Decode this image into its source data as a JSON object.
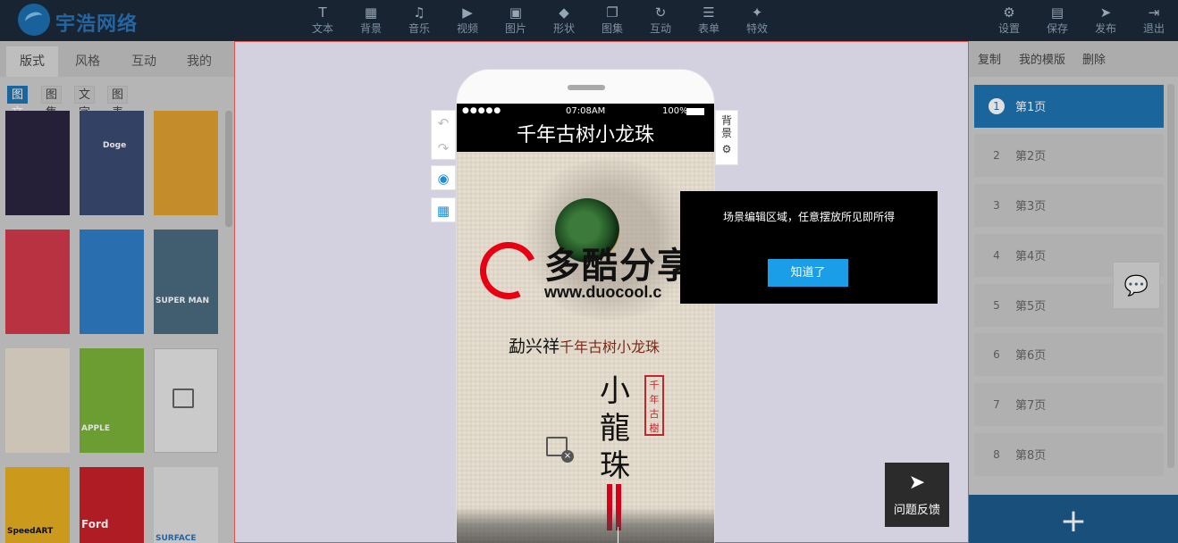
{
  "brand": {
    "name": "宇浩网络"
  },
  "toolbar": {
    "items": [
      {
        "label": "文本",
        "icon": "text-icon",
        "glyph": "T"
      },
      {
        "label": "背景",
        "icon": "background-icon",
        "glyph": "▦"
      },
      {
        "label": "音乐",
        "icon": "music-icon",
        "glyph": "♫"
      },
      {
        "label": "视频",
        "icon": "video-icon",
        "glyph": "▶"
      },
      {
        "label": "图片",
        "icon": "image-icon",
        "glyph": "▣"
      },
      {
        "label": "形状",
        "icon": "shape-icon",
        "glyph": "◆"
      },
      {
        "label": "图集",
        "icon": "gallery-icon",
        "glyph": "❐"
      },
      {
        "label": "互动",
        "icon": "interaction-icon",
        "glyph": "↻"
      },
      {
        "label": "表单",
        "icon": "form-icon",
        "glyph": "☰"
      },
      {
        "label": "特效",
        "icon": "effect-icon",
        "glyph": "✦"
      }
    ],
    "right": [
      {
        "label": "设置",
        "icon": "settings-icon",
        "glyph": "⚙"
      },
      {
        "label": "保存",
        "icon": "save-icon",
        "glyph": "▤"
      },
      {
        "label": "发布",
        "icon": "publish-icon",
        "glyph": "➤"
      },
      {
        "label": "退出",
        "icon": "exit-icon",
        "glyph": "⇥"
      }
    ]
  },
  "left": {
    "tabs": [
      "版式",
      "风格",
      "互动",
      "我的"
    ],
    "subtabs": [
      "图文",
      "图集",
      "文字",
      "图表"
    ],
    "thumbs": [
      {
        "color": "#2b2440",
        "text": ""
      },
      {
        "color": "#3a4a72",
        "text": "Doge"
      },
      {
        "color": "#e0a030",
        "text": ""
      },
      {
        "color": "#d23a4a",
        "text": ""
      },
      {
        "color": "#2f7fc8",
        "text": ""
      },
      {
        "color": "#4a6a80",
        "text": "SUPER MAN"
      },
      {
        "color": "#e8e0d0",
        "text": ""
      },
      {
        "color": "#7ab33a",
        "text": "APPLE"
      },
      {
        "color": "#e6e6e6",
        "text": ""
      },
      {
        "color": "#e8b020",
        "text": "SpeedART"
      },
      {
        "color": "#c8202a",
        "text": "Ford"
      },
      {
        "color": "#e0e0e0",
        "text": "SURFACE"
      }
    ]
  },
  "phone": {
    "status_time": "07:08AM",
    "battery": "100%",
    "title": "千年古树小龙珠",
    "brand_cn": "多酷分享",
    "brand_url": "www.duocool.c",
    "author": "勐兴祥",
    "author_product": "千年古树小龙珠",
    "vertical_title": [
      "小",
      "龍",
      "珠"
    ],
    "seal_text": "千年古樹"
  },
  "side": {
    "background_label": "背景"
  },
  "tip": {
    "message": "场景编辑区域，任意摆放所见即所得",
    "ok_label": "知道了"
  },
  "feedback": {
    "label": "问题反馈"
  },
  "right": {
    "actions": [
      "复制",
      "我的模版",
      "删除"
    ],
    "pages": [
      "第1页",
      "第2页",
      "第3页",
      "第4页",
      "第5页",
      "第6页",
      "第7页",
      "第8页"
    ],
    "active_page": 1,
    "add_label": "+"
  }
}
